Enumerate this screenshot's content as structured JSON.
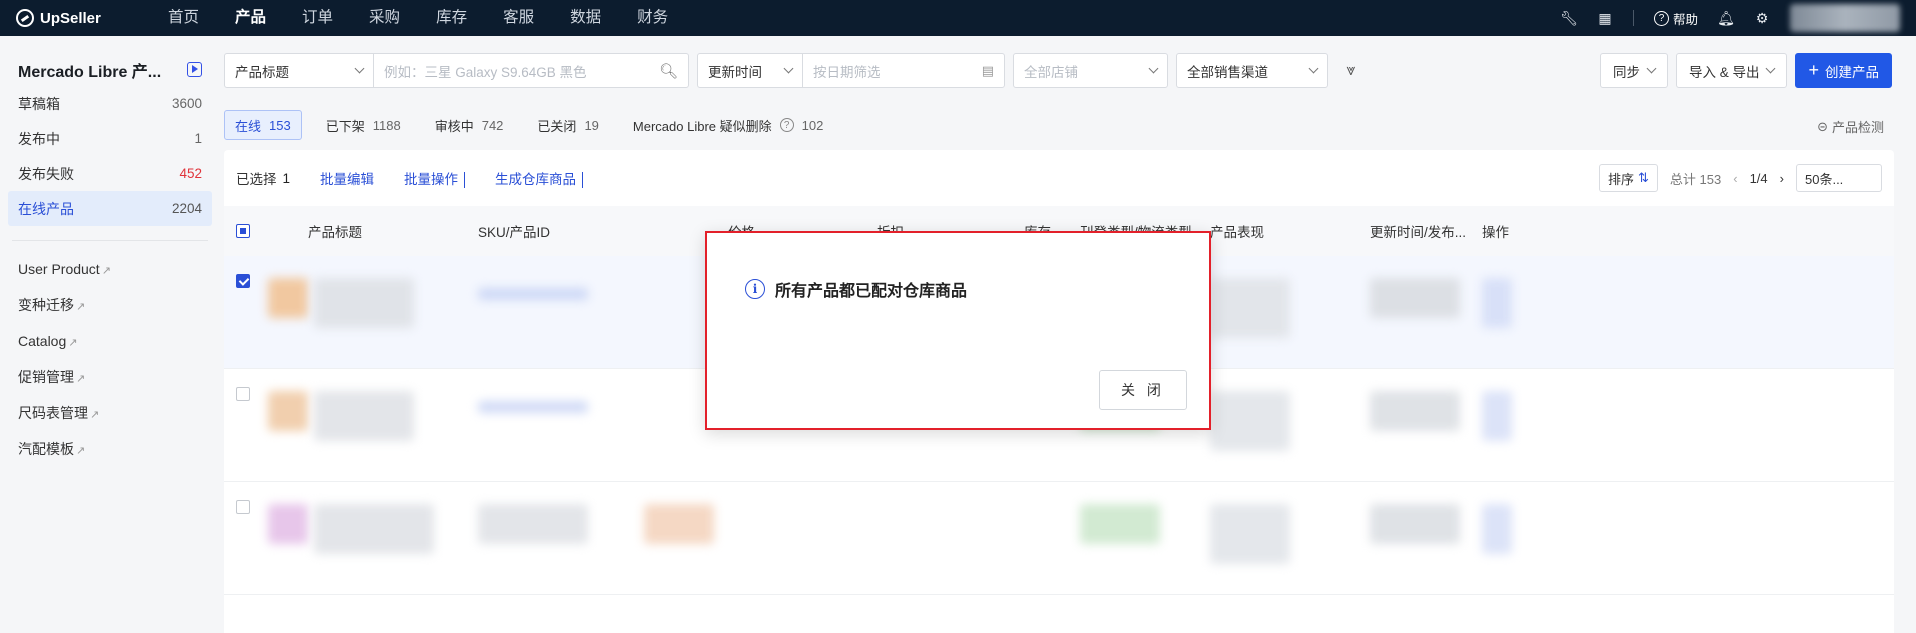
{
  "topnav": {
    "logo": "UpSeller",
    "items": [
      "首页",
      "产品",
      "订单",
      "采购",
      "库存",
      "客服",
      "数据",
      "财务"
    ],
    "active_index": 1,
    "help_label": "帮助"
  },
  "sidebar": {
    "title": "Mercado Libre 产...",
    "items": [
      {
        "label": "草稿箱",
        "count": "3600"
      },
      {
        "label": "发布中",
        "count": "1"
      },
      {
        "label": "发布失败",
        "count": "452"
      },
      {
        "label": "在线产品",
        "count": "2204"
      }
    ],
    "links": [
      "User Product",
      "变种迁移",
      "Catalog",
      "促销管理",
      "尺码表管理",
      "汽配模板"
    ]
  },
  "filters": {
    "field_select": "产品标题",
    "search_placeholder": "例如：三星 Galaxy S9.64GB 黑色",
    "time_select": "更新时间",
    "date_placeholder": "按日期筛选",
    "store_placeholder": "全部店铺",
    "channel_select": "全部销售渠道"
  },
  "actions": {
    "sync": "同步",
    "import_export": "导入 & 导出",
    "create": "创建产品"
  },
  "status_tabs": [
    {
      "label": "在线",
      "count": "153"
    },
    {
      "label": "已下架",
      "count": "1188"
    },
    {
      "label": "审核中",
      "count": "742"
    },
    {
      "label": "已关闭",
      "count": "19"
    },
    {
      "label": "Mercado Libre 疑似删除",
      "count": "102"
    }
  ],
  "detect_label": "产品检测",
  "bulk": {
    "selected_label": "已选择",
    "selected_count": "1",
    "edit": "批量编辑",
    "ops": "批量操作",
    "gen": "生成仓库商品"
  },
  "pager": {
    "sort": "排序",
    "total": "总计 153",
    "page": "1/4",
    "per_page": "50条..."
  },
  "columns": [
    "产品标题",
    "SKU/产品ID",
    "价格",
    "折扣",
    "库存",
    "刊登类型/物流类型",
    "产品表现",
    "更新时间/发布...",
    "操作"
  ],
  "dialog": {
    "message": "所有产品都已配对仓库商品",
    "close": "关 闭"
  },
  "colors": {
    "nav_bg": "#0c1c2e",
    "primary": "#2158e6",
    "alert_border": "#e3202a"
  }
}
